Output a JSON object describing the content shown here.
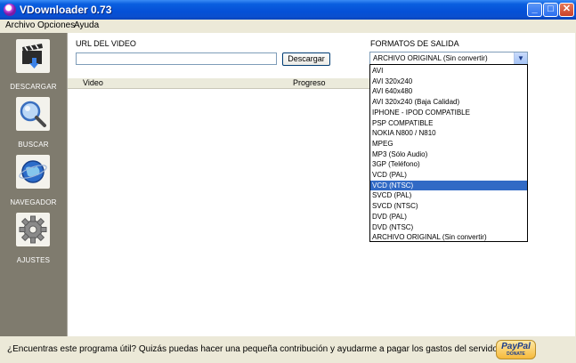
{
  "window": {
    "title": "VDownloader 0.73",
    "buttons": {
      "minimize": "_",
      "maximize": "□",
      "close": "✕"
    }
  },
  "menu": {
    "items": [
      "Archivo",
      "Opciones",
      "Ayuda"
    ]
  },
  "sidebar": {
    "items": [
      {
        "label": "DESCARGAR",
        "icon": "clapperboard-download-icon"
      },
      {
        "label": "BUSCAR",
        "icon": "magnifier-icon"
      },
      {
        "label": "NAVEGADOR",
        "icon": "globe-icon"
      },
      {
        "label": "AJUSTES",
        "icon": "gear-icon"
      }
    ]
  },
  "main": {
    "url_label": "URL DEL VIDEO",
    "url_value": "",
    "download_button": "Descargar",
    "formats_label": "FORMATOS DE SALIDA",
    "selected_format": "ARCHIVO ORIGINAL (Sin convertir)",
    "list_columns": [
      "Video",
      "Progreso"
    ],
    "format_options": [
      "AVI",
      "AVI 320x240",
      "AVI 640x480",
      "AVI 320x240 (Baja Calidad)",
      "IPHONE - IPOD COMPATIBLE",
      "PSP COMPATIBLE",
      "NOKIA N800 / N810",
      "MPEG",
      "MP3 (Sólo Audio)",
      "3GP (Teléfono)",
      "VCD (PAL)",
      "VCD (NTSC)",
      "SVCD (PAL)",
      "SVCD (NTSC)",
      "DVD (PAL)",
      "DVD (NTSC)",
      "ARCHIVO ORIGINAL (Sin convertir)"
    ],
    "highlighted_option": "VCD (NTSC)"
  },
  "footer": {
    "text": "¿Encuentras este programa útil? Quizás puedas hacer una pequeña contribución y ayudarme a pagar los gastos del servidor :-)",
    "paypal_logo": "PayPal",
    "paypal_donate": "DONATE"
  },
  "colors": {
    "titlebar": "#0550d6",
    "sidebar": "#7f7b6e",
    "selection": "#316ac5"
  }
}
